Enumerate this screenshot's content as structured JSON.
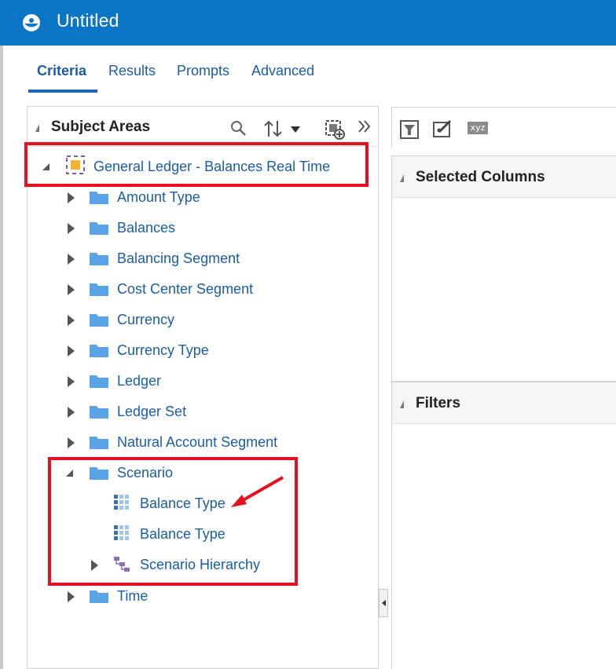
{
  "window": {
    "title": "Untitled"
  },
  "tabs": [
    {
      "label": "Criteria",
      "active": true
    },
    {
      "label": "Results",
      "active": false
    },
    {
      "label": "Prompts",
      "active": false
    },
    {
      "label": "Advanced",
      "active": false
    }
  ],
  "subject_areas": {
    "title": "Subject Areas",
    "toolbar_icons": [
      "search-icon",
      "sort-icon",
      "dropdown-icon",
      "create-criteria-icon",
      "expand-more-icon"
    ],
    "root": {
      "label": "General Ledger - Balances Real Time",
      "expanded": true
    },
    "folders": [
      {
        "label": "Amount Type",
        "expanded": false
      },
      {
        "label": "Balances",
        "expanded": false
      },
      {
        "label": "Balancing Segment",
        "expanded": false
      },
      {
        "label": "Cost Center Segment",
        "expanded": false
      },
      {
        "label": "Currency",
        "expanded": false
      },
      {
        "label": "Currency Type",
        "expanded": false
      },
      {
        "label": "Ledger",
        "expanded": false
      },
      {
        "label": "Ledger Set",
        "expanded": false
      },
      {
        "label": "Natural Account Segment",
        "expanded": false
      },
      {
        "label": "Scenario",
        "expanded": true,
        "children": [
          {
            "label": "Balance Type",
            "icon": "column-icon"
          },
          {
            "label": "Balance Type",
            "icon": "column-icon"
          },
          {
            "label": "Scenario Hierarchy",
            "icon": "hierarchy-icon",
            "expandable": true
          }
        ]
      },
      {
        "label": "Time",
        "expanded": false
      }
    ]
  },
  "right_panel": {
    "toolbar_icons": [
      "filter-icon",
      "edit-selection-icon",
      "xyz-icon"
    ],
    "xyz_text": "xyz",
    "selected_columns": {
      "title": "Selected Columns"
    },
    "filters": {
      "title": "Filters"
    }
  },
  "colors": {
    "titlebar": "#0b75c6",
    "link": "#1a5da6",
    "highlight": "#e8101e",
    "annotation_arrow": "#e8101e"
  }
}
